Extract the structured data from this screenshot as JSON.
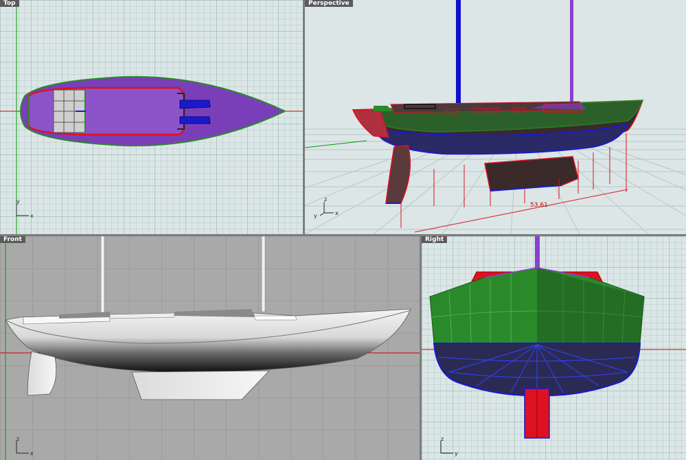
{
  "viewports": {
    "top": {
      "label": "Top",
      "axis_x": "x",
      "axis_y": "y"
    },
    "perspective": {
      "label": "Perspective",
      "axis_x": "x",
      "axis_y": "y",
      "axis_z": "z",
      "dimension": "53.61"
    },
    "front": {
      "label": "Front",
      "axis_x": "x",
      "axis_z": "z"
    },
    "right": {
      "label": "Right",
      "axis_y": "y",
      "axis_z": "z"
    }
  },
  "colors": {
    "grid_light_bg": "#dbe7e6",
    "grid_line": "#b5c7c7",
    "grid_major": "#8fa6a6",
    "shaded_bg": "#a9a9a9",
    "deck_purple": "#7a3fb8",
    "topsides_green": "#2a8a2a",
    "bottom_blue": "#1a1acc",
    "edge_red": "#dd1122",
    "hull_dark": "#3a2a2a",
    "axis_red": "#cc0000",
    "axis_green": "#009900",
    "mast_blue": "#1010cc",
    "mast_purple": "#8a3fd0"
  }
}
